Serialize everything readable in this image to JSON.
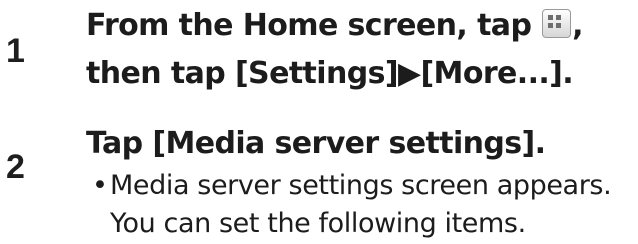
{
  "steps": [
    {
      "number": "1",
      "line1_before_icon": "From the Home screen, tap ",
      "icon": "apps-grid-icon",
      "line1_after_icon": ",",
      "line2": "then tap [Settings]▶[More...]."
    },
    {
      "number": "2",
      "heading": "Tap [Media server settings].",
      "bullet_symbol": "•",
      "bullet_line1": "Media server settings screen appears.",
      "bullet_line2": "You can set the following items."
    }
  ]
}
